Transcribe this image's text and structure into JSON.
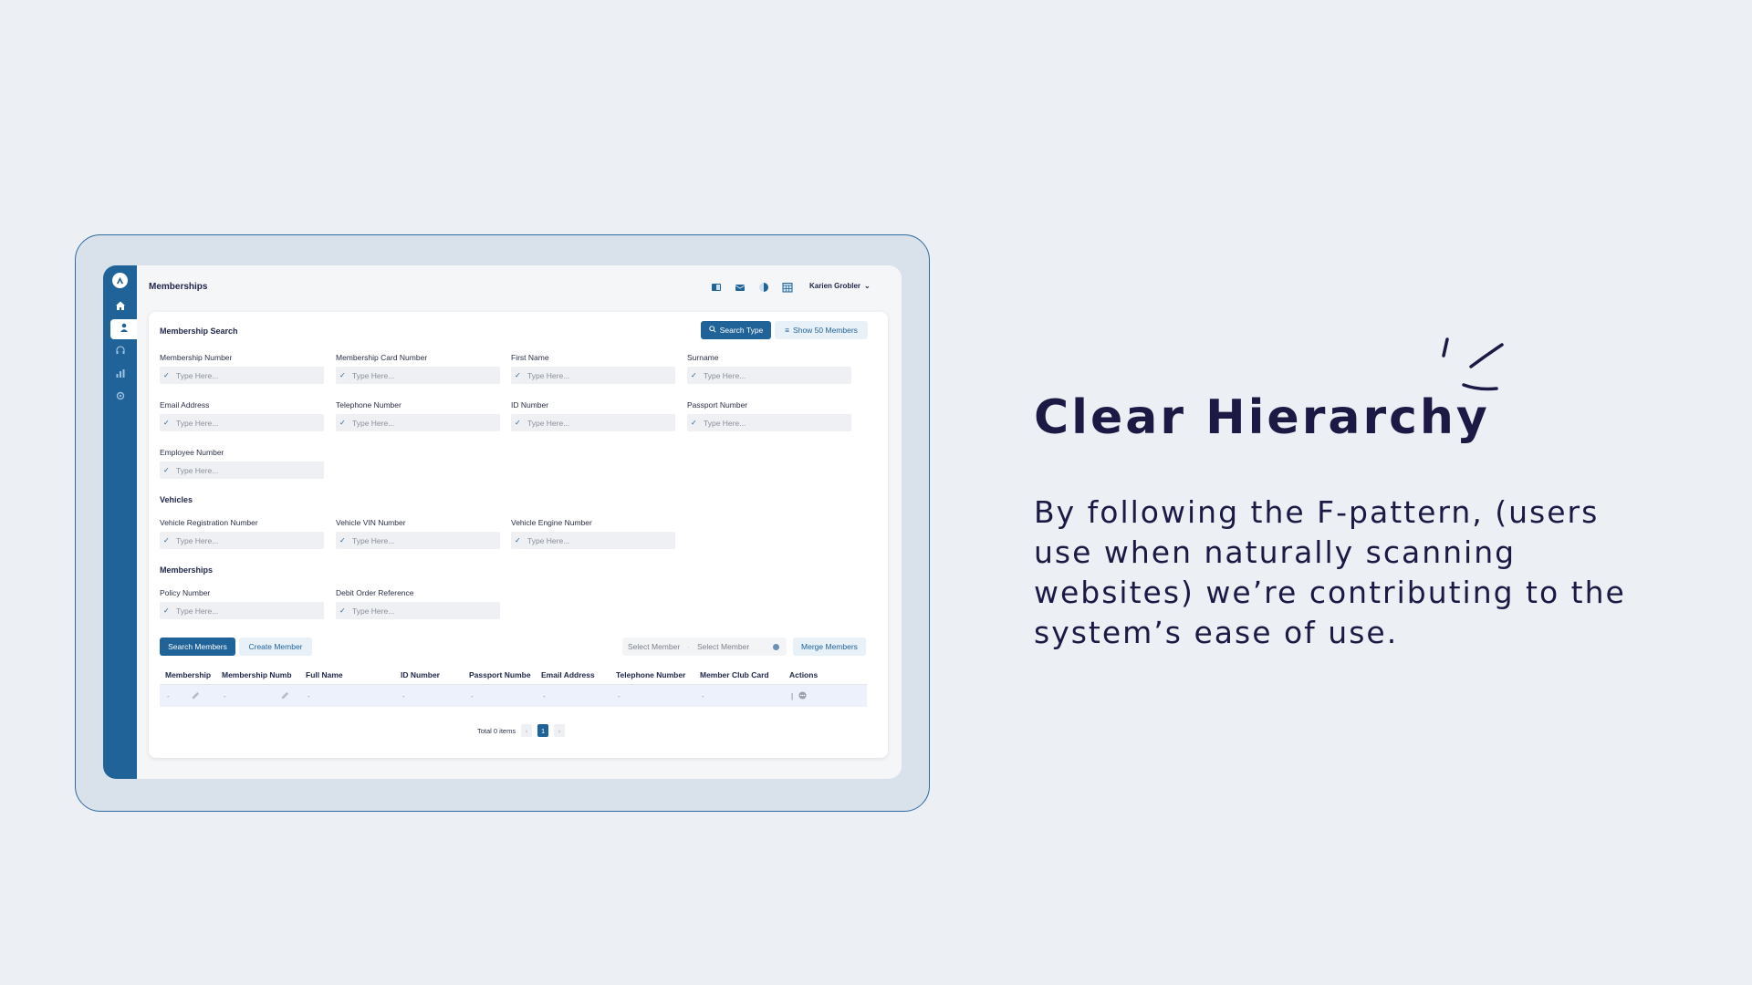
{
  "app": {
    "page_title": "Memberships",
    "user_name": "Karien Grobler",
    "topbar_icons": [
      "panel-icon",
      "inbox-icon",
      "half-circle-icon",
      "calendar-icon"
    ],
    "sidebar": {
      "items": [
        {
          "icon": "home-icon",
          "active": false
        },
        {
          "icon": "user-icon",
          "active": true
        },
        {
          "icon": "headset-icon",
          "active": false
        },
        {
          "icon": "chart-icon",
          "active": false
        },
        {
          "icon": "settings-icon",
          "active": false
        }
      ]
    }
  },
  "search": {
    "section_title": "Membership Search",
    "search_type_label": "Search Type",
    "show_members_label": "Show 50 Members",
    "placeholder": "Type Here...",
    "fields": {
      "membership_number": "Membership Number",
      "membership_card_number": "Membership Card Number",
      "first_name": "First Name",
      "surname": "Surname",
      "email_address": "Email Address",
      "telephone_number": "Telephone Number",
      "id_number": "ID Number",
      "passport_number": "Passport Number",
      "employee_number": "Employee Number"
    }
  },
  "vehicles": {
    "section_title": "Vehicles",
    "fields": {
      "registration": "Vehicle Registration Number",
      "vin": "Vehicle VIN Number",
      "engine": "Vehicle Engine Number"
    }
  },
  "memberships": {
    "section_title": "Memberships",
    "fields": {
      "policy": "Policy Number",
      "debit_order": "Debit Order Reference"
    }
  },
  "actions": {
    "search_members": "Search Members",
    "create_member": "Create Member",
    "select_member_1": "Select Member",
    "select_member_2": "Select Member",
    "merge_members": "Merge Members"
  },
  "table": {
    "columns": [
      "Membership",
      "Membership Numb",
      "Full Name",
      "ID Number",
      "Passport Numbe",
      "Email Address",
      "Telephone Number",
      "Member Club Card",
      "Actions"
    ],
    "row": [
      "-",
      "-",
      "-",
      "-",
      "-",
      "-",
      "-",
      "-"
    ]
  },
  "pagination": {
    "total": "Total 0 items",
    "current_page": "1",
    "prev": "‹",
    "next": "›"
  },
  "slide": {
    "headline": "Clear Hierarchy",
    "body": "By following the F-pattern, (users use when naturally scanning websites) we’re contributing to the system’s ease of use."
  },
  "colors": {
    "primary": "#1f6399",
    "text_dark": "#1c1a45",
    "background": "#eceff3"
  }
}
